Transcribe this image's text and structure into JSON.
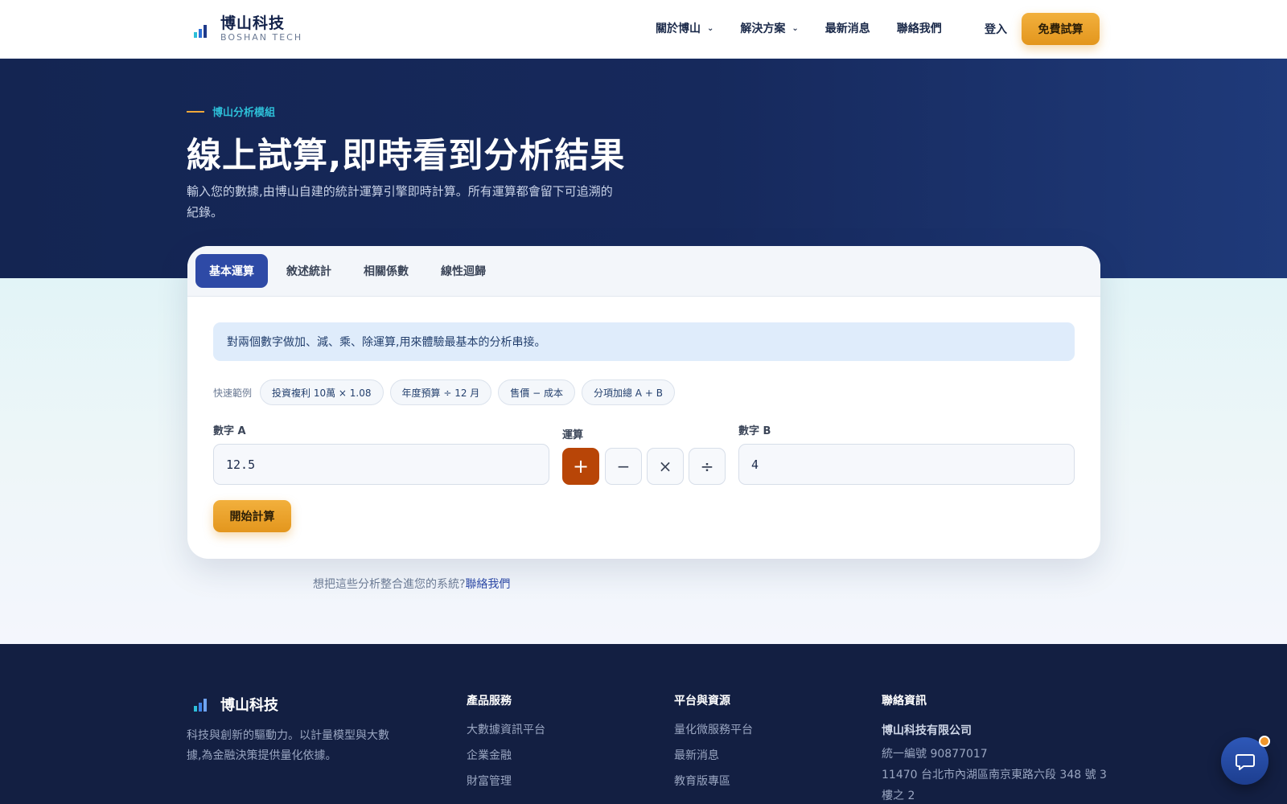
{
  "brand": {
    "name": "博山科技",
    "sub": "BOSHAN TECH"
  },
  "nav": [
    {
      "label": "關於博山",
      "has_dropdown": true
    },
    {
      "label": "解決方案",
      "has_dropdown": true
    },
    {
      "label": "最新消息",
      "has_dropdown": false
    },
    {
      "label": "聯絡我們",
      "has_dropdown": false
    }
  ],
  "header": {
    "login": "登入",
    "cta": "免費試算"
  },
  "hero": {
    "eyebrow": "博山分析模組",
    "title": "線上試算,即時看到分析結果",
    "desc": "輸入您的數據,由博山自建的統計運算引擎即時計算。所有運算都會留下可追溯的紀錄。"
  },
  "tabs": [
    {
      "label": "基本運算",
      "active": true
    },
    {
      "label": "敘述統計",
      "active": false
    },
    {
      "label": "相關係數",
      "active": false
    },
    {
      "label": "線性迴歸",
      "active": false
    }
  ],
  "calculator": {
    "info": "對兩個數字做加、減、乘、除運算,用來體驗最基本的分析串接。",
    "quick_label": "快速範例",
    "examples": [
      "投資複利 10萬 × 1.08",
      "年度預算 ÷ 12 月",
      "售價 − 成本",
      "分項加總 A + B"
    ],
    "a_label": "數字 A",
    "a_value": "12.5",
    "op_label": "運算",
    "operators": [
      {
        "symbol": "+",
        "name": "add",
        "active": true
      },
      {
        "symbol": "−",
        "name": "subtract",
        "active": false
      },
      {
        "symbol": "×",
        "name": "multiply",
        "active": false
      },
      {
        "symbol": "÷",
        "name": "divide",
        "active": false
      }
    ],
    "b_label": "數字 B",
    "b_value": "4",
    "submit": "開始計算"
  },
  "integrate": {
    "text": "想把這些分析整合進您的系統?",
    "link": "聯絡我們"
  },
  "footer": {
    "brand": "博山科技",
    "desc": "科技與創新的驅動力。以計量模型與大數據,為金融決策提供量化依據。",
    "products": {
      "title": "產品服務",
      "items": [
        "大數據資訊平台",
        "企業金融",
        "財富管理"
      ]
    },
    "resources": {
      "title": "平台與資源",
      "items": [
        "量化微服務平台",
        "最新消息",
        "教育版專區"
      ]
    },
    "contact": {
      "title": "聯絡資訊",
      "company": "博山科技有限公司",
      "lines": [
        "統一編號 90877017",
        "11470 台北市內湖區南京東路六段 348 號 3 樓之 2"
      ]
    }
  },
  "icons": {
    "logo": "bar-chart-logo-icon",
    "chat": "chat-bubble-icon",
    "chevron": "chevron-down-icon"
  },
  "colors": {
    "navy": "#142552",
    "accent": "#e3961d",
    "primary": "#2e4aa6",
    "operator_active": "#b84507",
    "teal": "#2dbfd8"
  }
}
